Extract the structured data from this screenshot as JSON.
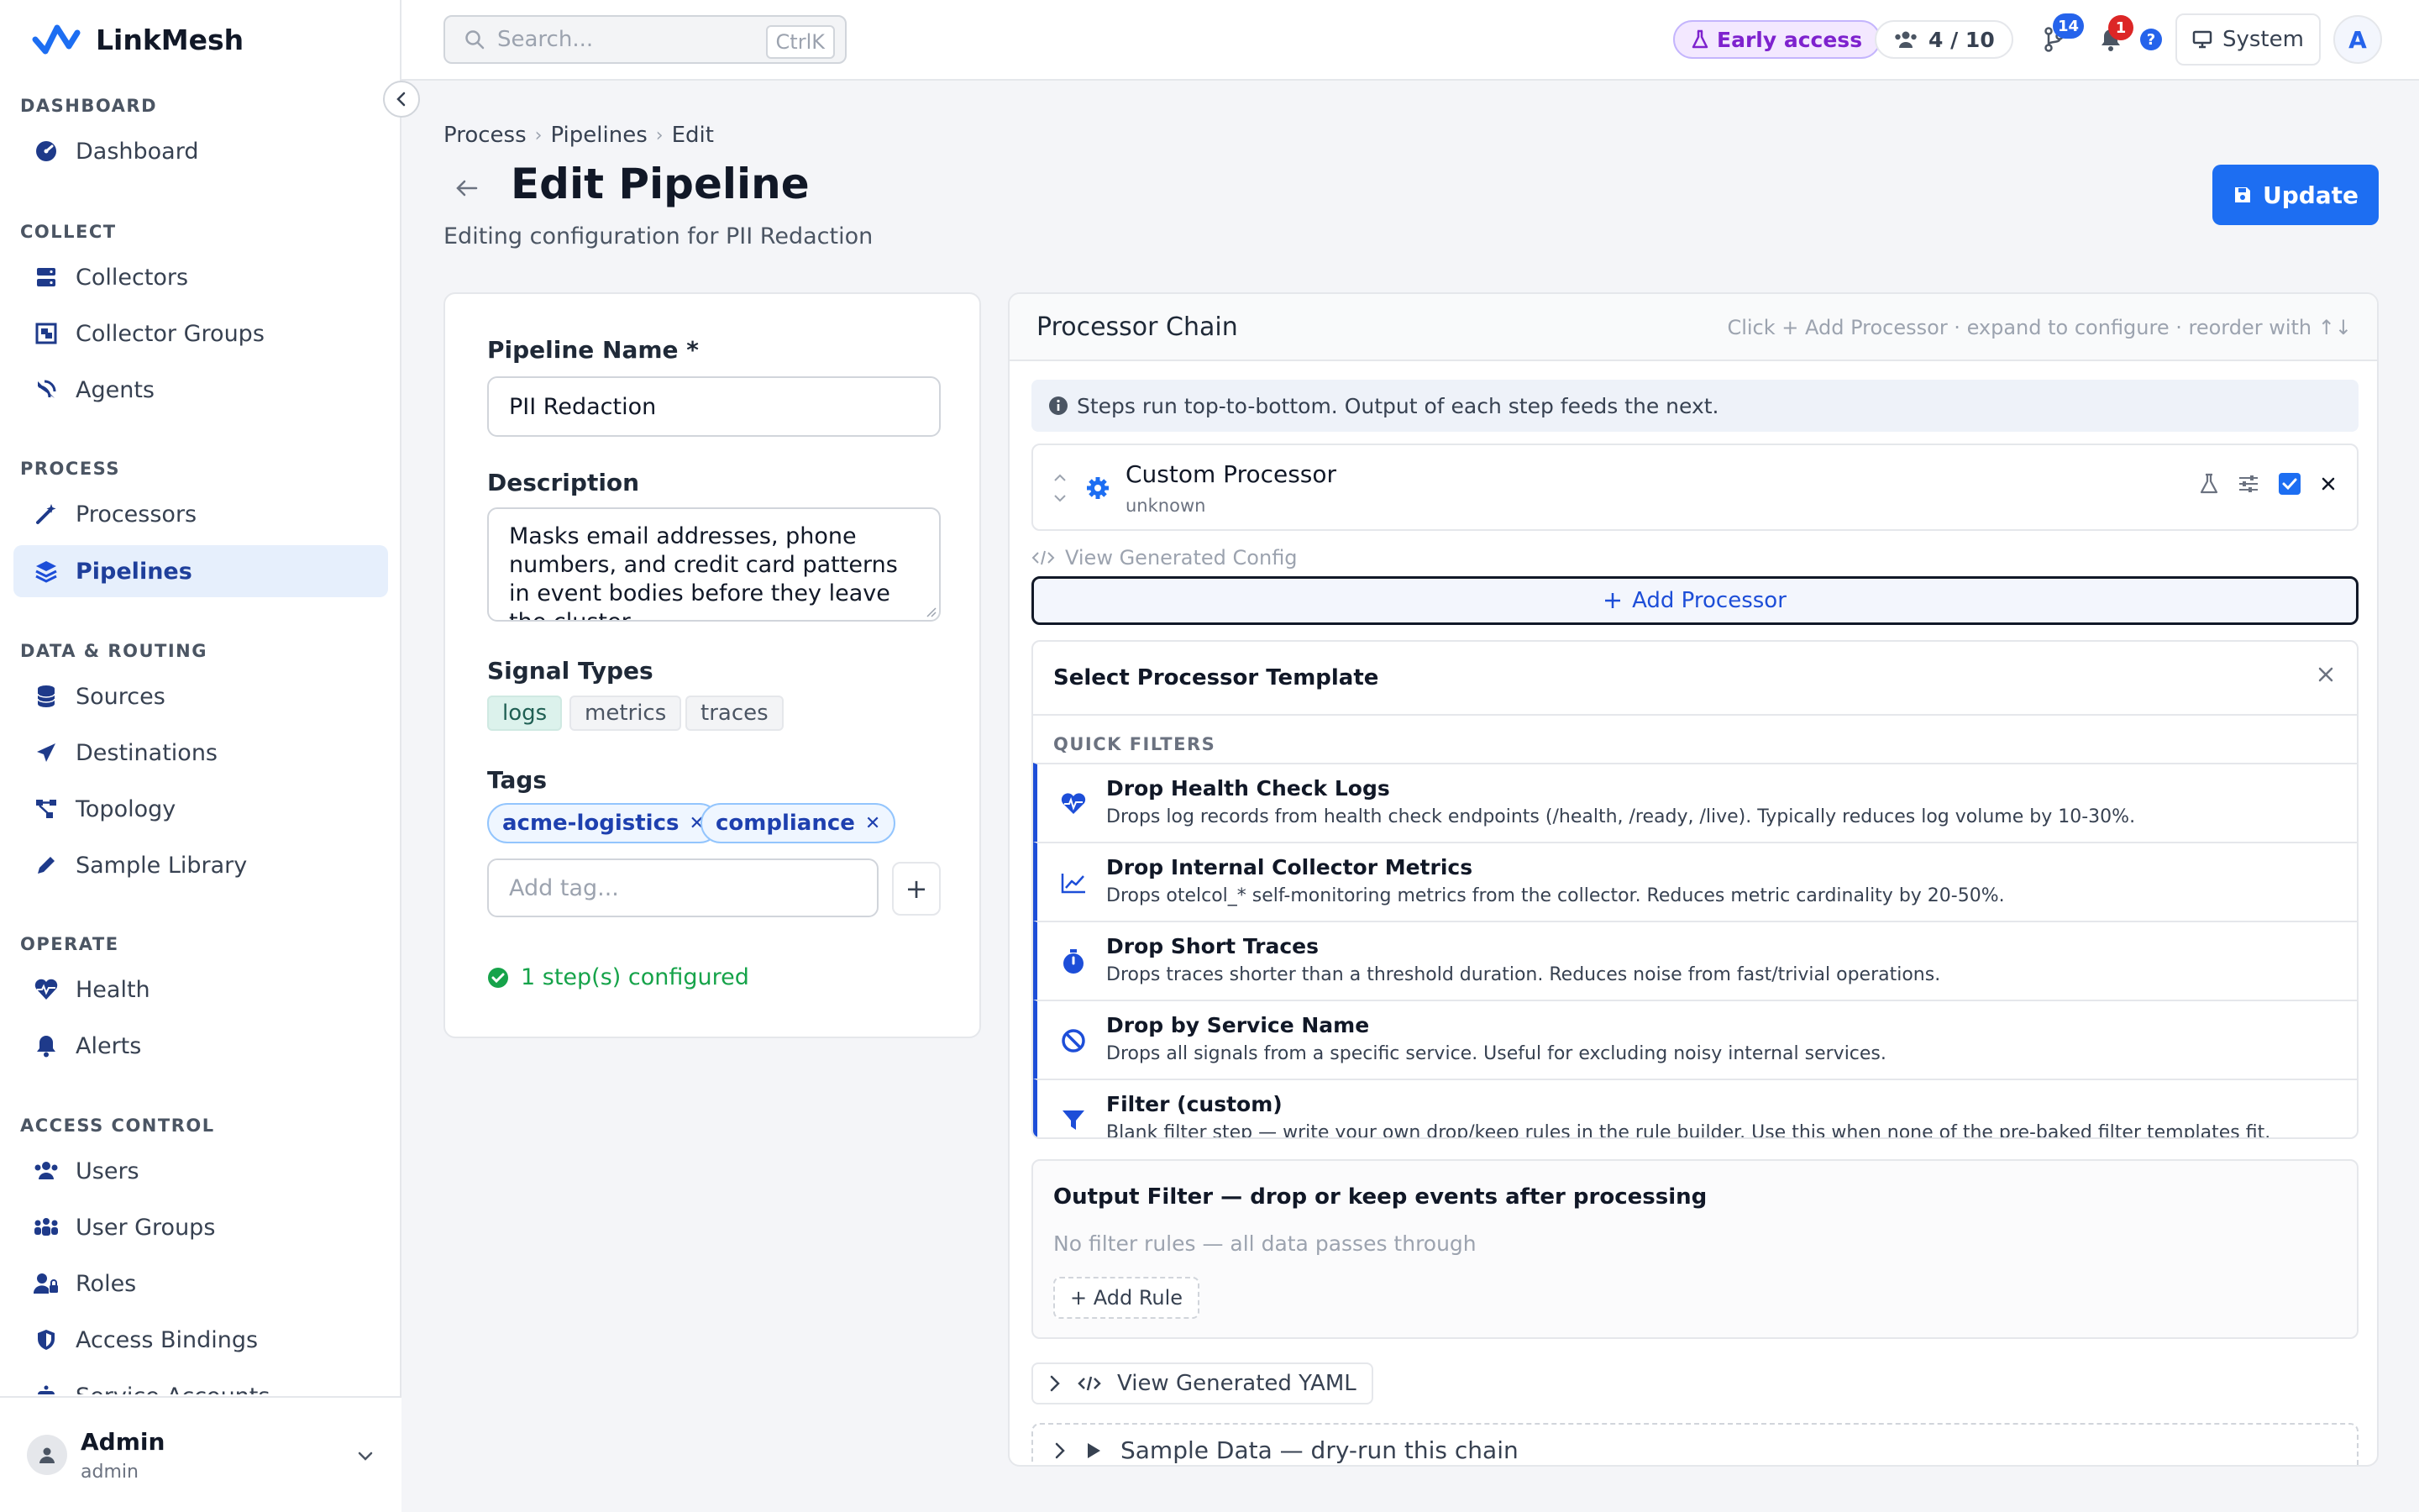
{
  "app": {
    "name": "LinkMesh"
  },
  "sidebar": {
    "sections": [
      {
        "title": "DASHBOARD",
        "items": [
          {
            "label": "Dashboard",
            "icon": "gauge-icon"
          }
        ]
      },
      {
        "title": "COLLECT",
        "items": [
          {
            "label": "Collectors",
            "icon": "server-icon"
          },
          {
            "label": "Collector Groups",
            "icon": "object-group-icon"
          },
          {
            "label": "Agents",
            "icon": "satellite-dish-icon"
          }
        ]
      },
      {
        "title": "PROCESS",
        "items": [
          {
            "label": "Processors",
            "icon": "magic-wand-icon"
          },
          {
            "label": "Pipelines",
            "icon": "layers-icon",
            "active": true
          }
        ]
      },
      {
        "title": "DATA & ROUTING",
        "items": [
          {
            "label": "Sources",
            "icon": "database-icon"
          },
          {
            "label": "Destinations",
            "icon": "paper-plane-icon"
          },
          {
            "label": "Topology",
            "icon": "topology-icon"
          },
          {
            "label": "Sample Library",
            "icon": "pen-icon"
          }
        ]
      },
      {
        "title": "OPERATE",
        "items": [
          {
            "label": "Health",
            "icon": "heart-pulse-icon"
          },
          {
            "label": "Alerts",
            "icon": "bell-icon"
          }
        ]
      },
      {
        "title": "ACCESS CONTROL",
        "items": [
          {
            "label": "Users",
            "icon": "users-icon"
          },
          {
            "label": "User Groups",
            "icon": "people-group-icon"
          },
          {
            "label": "Roles",
            "icon": "user-lock-icon"
          },
          {
            "label": "Access Bindings",
            "icon": "shield-icon"
          },
          {
            "label": "Service Accounts",
            "icon": "robot-icon"
          }
        ]
      }
    ],
    "user": {
      "name": "Admin",
      "role": "admin"
    }
  },
  "topbar": {
    "search_placeholder": "Search...",
    "search_shortcut": "CtrlK",
    "early_access": "Early access",
    "seats": "4 / 10",
    "pipelines_badge": "14",
    "notifications_badge": "1",
    "help": "?",
    "theme": "System",
    "avatar_initial": "A"
  },
  "header": {
    "breadcrumb": [
      "Process",
      "Pipelines",
      "Edit"
    ],
    "title": "Edit Pipeline",
    "subtitle": "Editing configuration for PII Redaction",
    "update_label": "Update"
  },
  "form": {
    "name_label": "Pipeline Name *",
    "name_value": "PII Redaction",
    "description_label": "Description",
    "description_value": "Masks email addresses, phone numbers, and credit card patterns in event bodies before they leave the cluster.",
    "signal_types_label": "Signal Types",
    "signal_types": [
      {
        "label": "logs",
        "selected": true
      },
      {
        "label": "metrics",
        "selected": false
      },
      {
        "label": "traces",
        "selected": false
      }
    ],
    "tags_label": "Tags",
    "tags": [
      "acme-logistics",
      "compliance"
    ],
    "add_tag_placeholder": "Add tag...",
    "status": "1 step(s) configured"
  },
  "chain": {
    "title": "Processor Chain",
    "hint": "Click + Add Processor · expand to configure · reorder with ↑↓",
    "info": "Steps run top-to-bottom. Output of each step feeds the next.",
    "steps": [
      {
        "name": "Custom Processor",
        "type": "unknown",
        "enabled": true
      }
    ],
    "view_config": "View Generated Config",
    "add_processor": "Add Processor",
    "template_panel": {
      "title": "Select Processor Template",
      "quick_filters": "QUICK FILTERS",
      "items": [
        {
          "title": "Drop Health Check Logs",
          "desc": "Drops log records from health check endpoints (/health, /ready, /live). Typically reduces log volume by 10-30%.",
          "icon": "heart-pulse-icon"
        },
        {
          "title": "Drop Internal Collector Metrics",
          "desc": "Drops otelcol_* self-monitoring metrics from the collector. Reduces metric cardinality by 20-50%.",
          "icon": "chart-line-icon"
        },
        {
          "title": "Drop Short Traces",
          "desc": "Drops traces shorter than a threshold duration. Reduces noise from fast/trivial operations.",
          "icon": "stopwatch-icon"
        },
        {
          "title": "Drop by Service Name",
          "desc": "Drops all signals from a specific service. Useful for excluding noisy internal services.",
          "icon": "ban-icon"
        },
        {
          "title": "Filter (custom)",
          "desc": "Blank filter step — write your own drop/keep rules in the rule builder. Use this when none of the pre-baked filter templates fit.",
          "icon": "funnel-icon"
        }
      ]
    },
    "output_filter": {
      "title": "Output Filter — drop or keep events after processing",
      "empty": "No filter rules — all data passes through",
      "add_rule": "+ Add Rule"
    },
    "view_yaml": "View Generated YAML",
    "sample_data": "Sample Data — dry-run this chain"
  },
  "colors": {
    "primary": "#1d6ef2",
    "active_nav_bg": "#e6effc",
    "success": "#16a34a",
    "early_access": "#7e22ce"
  }
}
